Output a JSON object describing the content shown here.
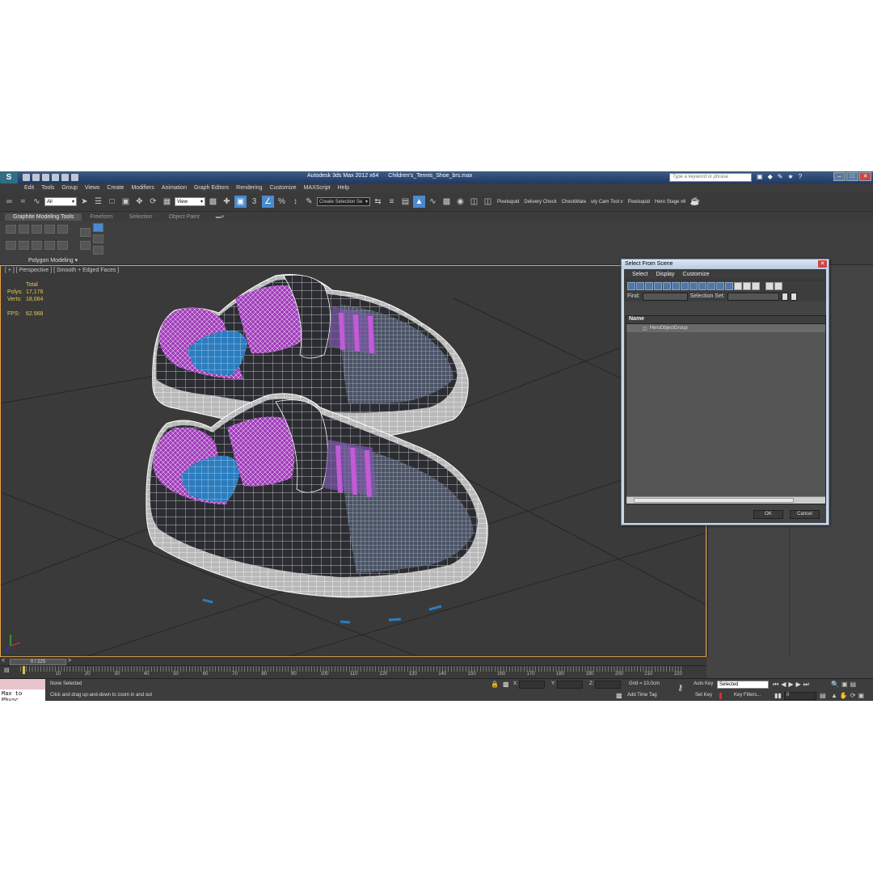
{
  "window": {
    "app_title": "Autodesk 3ds Max  2012 x64",
    "file_name": "Children's_Tennis_Shoe_brs.max",
    "search_placeholder": "Type a keyword or phrase",
    "min": "–",
    "max": "□",
    "close": "✕"
  },
  "menu": [
    "Edit",
    "Tools",
    "Group",
    "Views",
    "Create",
    "Modifiers",
    "Animation",
    "Graph Editors",
    "Rendering",
    "Customize",
    "MAXScript",
    "Help"
  ],
  "toolbar": {
    "selection_filter": "All",
    "ref_coord": "View",
    "named_selection": "Create Selection Se",
    "plugin_labels": [
      "Pixelsquid",
      "Delivery Check",
      "CheckMate",
      "uty Cam Tool v",
      "Pixelsquid",
      "Hero Stage v6"
    ]
  },
  "ribbon": {
    "tabs": [
      "Graphite Modeling Tools",
      "Freeform",
      "Selection",
      "Object Paint"
    ],
    "active_tab": "Graphite Modeling Tools",
    "panel_label": "Polygon Modeling"
  },
  "viewport": {
    "label": "[ + ] [ Perspective ] [ Smooth + Edged Faces ]",
    "stats": {
      "header": "Total",
      "polys_label": "Polys:",
      "polys": "17,176",
      "verts_label": "Verts:",
      "verts": "18,064",
      "fps_label": "FPS:",
      "fps": "62.968"
    },
    "colors": {
      "purple": "#b03ec8",
      "blue": "#2a7ac2",
      "dark": "#2b2b30",
      "sole": "#d8d8d8",
      "wire": "#ffffff",
      "active_border": "#e8a14a"
    }
  },
  "dialog": {
    "title": "Select From Scene",
    "menu": [
      "Select",
      "Display",
      "Customize"
    ],
    "find_label": "Find:",
    "selection_set_label": "Selection Set:",
    "column_name": "Name",
    "items": [
      "HeroObjectGroup"
    ],
    "ok": "OK",
    "cancel": "Cancel"
  },
  "timeline": {
    "position": "0 / 225",
    "current_frame": 0,
    "total_frames": 225,
    "labels": [
      "10",
      "20",
      "30",
      "40",
      "50",
      "60",
      "70",
      "80",
      "90",
      "100",
      "110",
      "120",
      "130",
      "140",
      "150",
      "160",
      "170",
      "180",
      "190",
      "200",
      "210",
      "220"
    ]
  },
  "status": {
    "maxscript_text": "Max to Physc.",
    "selection": "None Selected",
    "prompt": "Click and drag up-and-down to zoom in and out",
    "x_label": "X:",
    "y_label": "Y:",
    "z_label": "Z:",
    "grid": "Grid = 10,0cm",
    "add_time_tag": "Add Time Tag",
    "auto_key": "Auto Key",
    "auto_key_value": "Selected",
    "set_key": "Set Key",
    "key_filters": "Key Filters...",
    "frame": "0"
  }
}
